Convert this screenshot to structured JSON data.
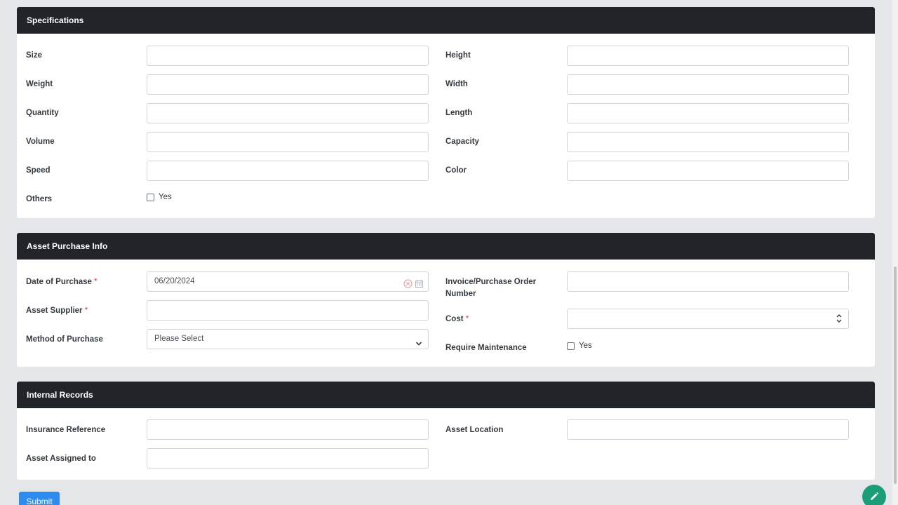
{
  "specifications": {
    "title": "Specifications",
    "left_fields": [
      "Size",
      "Weight",
      "Quantity",
      "Volume",
      "Speed"
    ],
    "right_fields": [
      "Height",
      "Width",
      "Length",
      "Capacity",
      "Color"
    ],
    "others_label": "Others",
    "others_checkbox_label": "Yes"
  },
  "purchase": {
    "title": "Asset Purchase Info",
    "date_label": "Date of Purchase",
    "date_value": "06/20/2024",
    "supplier_label": "Asset Supplier",
    "method_label": "Method of Purchase",
    "method_value": "Please Select",
    "invoice_label": "Invoice/Purchase Order Number",
    "cost_label": "Cost",
    "maintenance_label": "Require Maintenance",
    "maintenance_checkbox_label": "Yes",
    "required_marker": "*"
  },
  "internal": {
    "title": "Internal Records",
    "insurance_label": "Insurance Reference",
    "assigned_label": "Asset Assigned to",
    "location_label": "Asset Location"
  },
  "submit_label": "Submit",
  "icons": {
    "clear": "clear-circle-icon",
    "calendar": "calendar-icon",
    "chevron": "chevron-down-icon",
    "spinner": "updown-spinner-icon",
    "edit": "pencil-icon"
  }
}
